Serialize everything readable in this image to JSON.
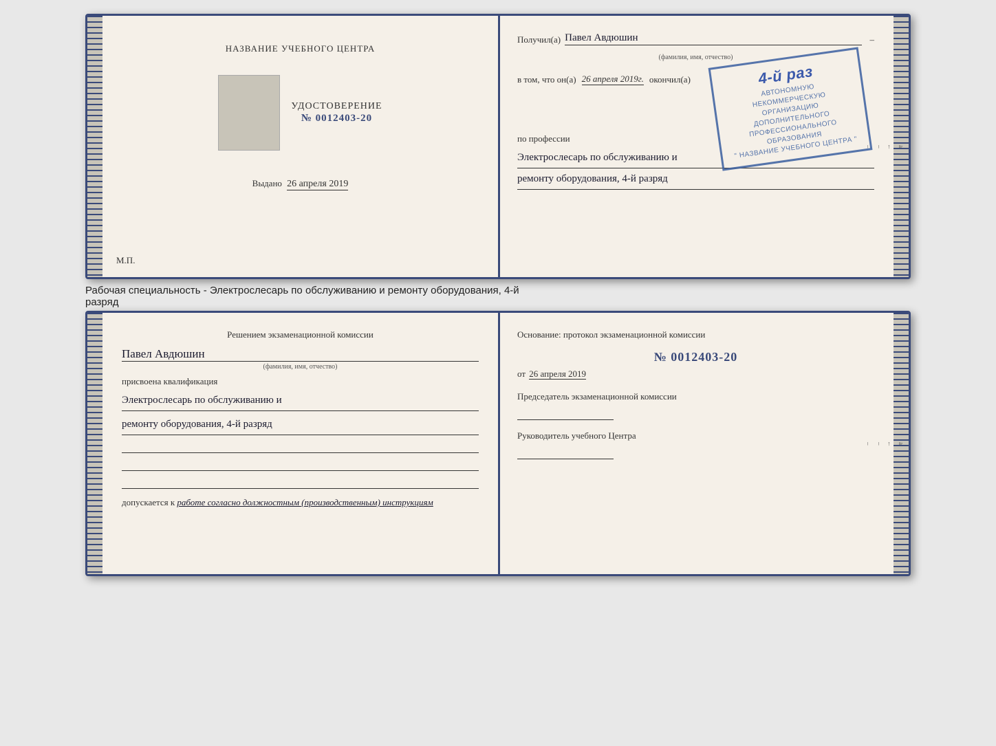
{
  "top_booklet": {
    "left": {
      "center_title": "НАЗВАНИЕ УЧЕБНОГО ЦЕНТРА",
      "cert_label": "УДОСТОВЕРЕНИЕ",
      "cert_number": "№ 0012403-20",
      "issued_label": "Выдано",
      "issued_date": "26 апреля 2019",
      "mp": "М.П."
    },
    "right": {
      "received_label": "Получил(а)",
      "person_name": "Павел Авдюшин",
      "name_hint": "(фамилия, имя, отчество)",
      "in_that_label": "в том, что он(а)",
      "date_label": "26 апреля 2019г.",
      "finished_label": "окончил(а)",
      "stamp_line1": "АВТОНОМНУЮ НЕКОММЕРЧЕСКУЮ ОРГАНИЗАЦИЮ",
      "stamp_line2": "ДОПОЛНИТЕЛЬНОГО ПРОФЕССИОНАЛЬНОГО ОБРАЗОВАНИЯ",
      "stamp_line3": "\" НАЗВАНИЕ УЧЕБНОГО ЦЕНТРА \"",
      "stamp_grade": "4-й раз",
      "profession_label": "по профессии",
      "profession_text_line1": "Электрослесарь по обслуживанию и",
      "profession_text_line2": "ремонту оборудования, 4-й разряд"
    },
    "spine_right_labels": [
      "–",
      "–",
      "–",
      "и",
      "а",
      "←",
      "–",
      "–",
      "–",
      "–"
    ]
  },
  "description": {
    "text": "Рабочая специальность - Электрослесарь по обслуживанию и ремонту оборудования, 4-й",
    "text2": "разряд"
  },
  "bottom_booklet": {
    "left": {
      "decision_label": "Решением экзаменационной комиссии",
      "person_name": "Павел Авдюшин",
      "name_hint": "(фамилия, имя, отчество)",
      "assigned_label": "присвоена квалификация",
      "qualification_line1": "Электрослесарь по обслуживанию и",
      "qualification_line2": "ремонту оборудования, 4-й разряд",
      "admitted_label": "допускается к",
      "admitted_text": "работе согласно должностным (производственным) инструкциям"
    },
    "right": {
      "basis_label": "Основание: протокол экзаменационной комиссии",
      "basis_number": "№ 0012403-20",
      "date_prefix": "от",
      "basis_date": "26 апреля 2019",
      "chairman_label": "Председатель экзаменационной комиссии",
      "head_label": "Руководитель учебного Центра"
    },
    "spine_right_labels": [
      "–",
      "–",
      "–",
      "–",
      "и",
      "а",
      "←",
      "–",
      "–",
      "–",
      "–"
    ]
  }
}
